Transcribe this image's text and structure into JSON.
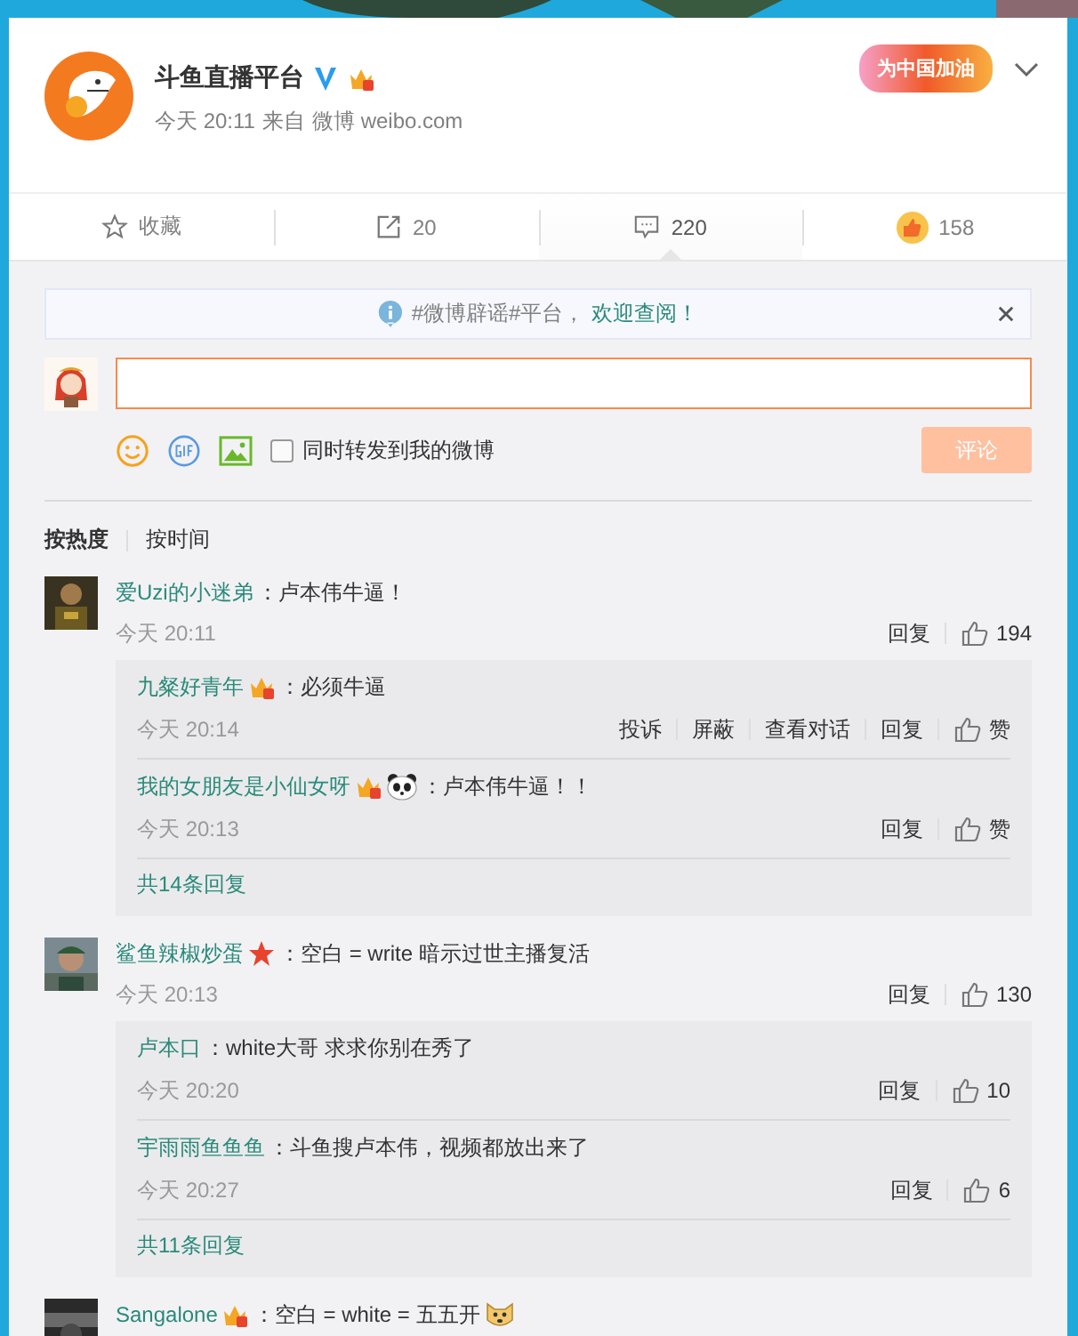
{
  "post": {
    "author": "斗鱼直播平台",
    "verified": true,
    "badges": [
      {
        "kind": "crown"
      }
    ],
    "time": "今天 20:11",
    "source_prefix": "来自",
    "source": "微博 weibo.com",
    "banner": "为中国加油"
  },
  "actions": [
    {
      "kind": "favorite",
      "label": "收藏",
      "selected": false
    },
    {
      "kind": "repost",
      "label": "20",
      "selected": false
    },
    {
      "kind": "comment",
      "label": "220",
      "selected": true
    },
    {
      "kind": "like",
      "label": "158",
      "selected": false
    }
  ],
  "notice": {
    "text": "#微博辟谣#平台，",
    "link": "欢迎查阅！"
  },
  "composer": {
    "repost_label": "同时转发到我的微博",
    "repost_checked": false,
    "submit": "评论",
    "submit_disabled": true
  },
  "sort_tabs": [
    {
      "label": "按热度",
      "selected": true
    },
    {
      "label": "按时间",
      "selected": false
    }
  ],
  "comments": [
    {
      "user": "爱Uzi的小迷弟",
      "text": "：卢本伟牛逼！",
      "time": "今天 20:11",
      "reply": "回复",
      "likes": "194",
      "replies": [
        {
          "user": "九粲好青年",
          "badges": [
            {
              "kind": "crown"
            }
          ],
          "text": "：必须牛逼",
          "time": "今天 20:14",
          "actions": [
            "投诉",
            "屏蔽",
            "查看对话",
            "回复"
          ],
          "likes": "赞"
        },
        {
          "user": "我的女朋友是小仙女呀",
          "badges": [
            {
              "kind": "crown"
            },
            {
              "kind": "panda"
            }
          ],
          "text": "：卢本伟牛逼！！",
          "time": "今天 20:13",
          "actions": [
            "回复"
          ],
          "likes": "赞"
        }
      ],
      "more": "共14条回复"
    },
    {
      "user": "鲨鱼辣椒炒蛋",
      "badges": [
        {
          "kind": "star"
        }
      ],
      "text": "：空白 = write 暗示过世主播复活",
      "time": "今天 20:13",
      "reply": "回复",
      "likes": "130",
      "replies": [
        {
          "user": "卢本口",
          "text": "：white大哥 求求你别在秀了",
          "time": "今天 20:20",
          "actions": [
            "回复"
          ],
          "likes": "10"
        },
        {
          "user": "宇雨雨鱼鱼鱼",
          "text": "：斗鱼搜卢本伟，视频都放出来了",
          "time": "今天 20:27",
          "actions": [
            "回复"
          ],
          "likes": "6"
        }
      ],
      "more": "共11条回复"
    },
    {
      "user": "Sangalone",
      "badges": [
        {
          "kind": "crown"
        }
      ],
      "text": "：空白 = white = 五五开",
      "trailing_icon": {
        "kind": "doge"
      }
    }
  ]
}
